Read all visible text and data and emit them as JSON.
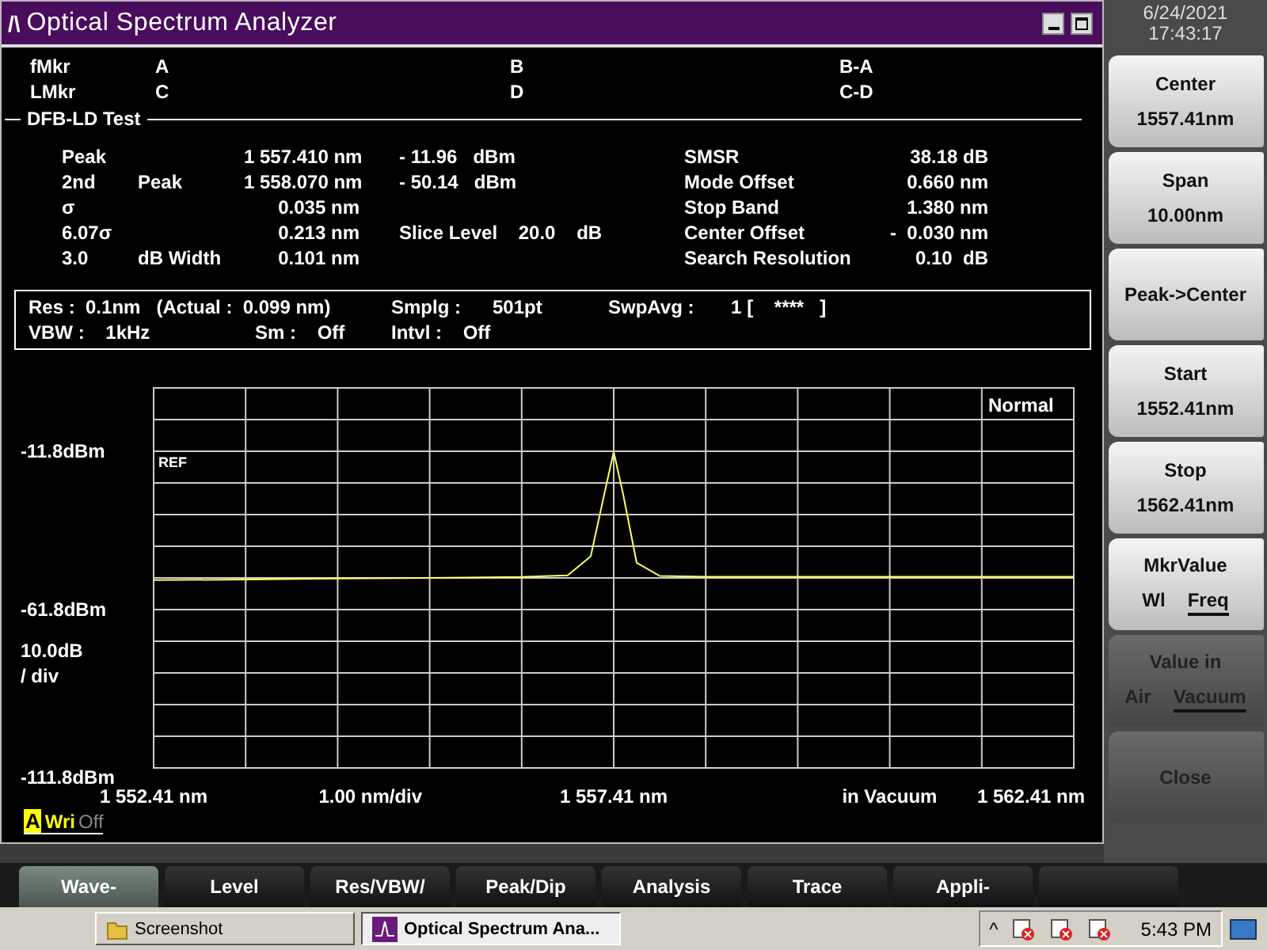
{
  "window": {
    "title": "Optical Spectrum Analyzer",
    "logo": "/\\"
  },
  "markers": [
    {
      "label": "fMkr",
      "a": "A",
      "b": "B",
      "diff": "B-A"
    },
    {
      "label": "LMkr",
      "a": "C",
      "b": "D",
      "diff": "C-D"
    }
  ],
  "test": {
    "title": "DFB-LD Test",
    "left_rows": [
      {
        "label": "Peak",
        "sub": "",
        "value": "1 557.410 nm",
        "extra": "- 11.96   dBm"
      },
      {
        "label": "2nd",
        "sub": "Peak",
        "value": "1 558.070 nm",
        "extra": "- 50.14   dBm"
      },
      {
        "label": "σ",
        "sub": "",
        "value": "0.035 nm",
        "extra": ""
      },
      {
        "label": "6.07σ",
        "sub": "",
        "value": "0.213 nm",
        "extra": "Slice Level    20.0    dB"
      },
      {
        "label": "3.0",
        "sub": "dB Width",
        "value": "0.101 nm",
        "extra": ""
      }
    ],
    "right_rows": [
      {
        "label": "SMSR",
        "value": "38.18 dB"
      },
      {
        "label": "Mode Offset",
        "value": "0.660 nm"
      },
      {
        "label": "Stop Band",
        "value": "1.380 nm"
      },
      {
        "label": "Center Offset",
        "value": "-  0.030 nm"
      },
      {
        "label": "Search Resolution",
        "value": "0.10  dB"
      }
    ]
  },
  "settings": [
    [
      "Res :  0.1nm   (Actual :  0.099 nm)",
      "Smplg :      501pt",
      "SwpAvg :       1 [    ****   ]"
    ],
    [
      "VBW :    1kHz",
      "Sm :    Off",
      "Intvl :    Off"
    ]
  ],
  "trace": {
    "mode_label": "Normal",
    "ref_label": "REF",
    "ydiv": "10.0dB\n/ div",
    "xdiv": "1.00 nm/div",
    "medium": "in Vacuum",
    "x_end_label": "1 562.41 nm",
    "write": "Wri",
    "state": "Off",
    "chart_data": {
      "type": "line",
      "x": [
        1552.41,
        1553.41,
        1554.41,
        1555.41,
        1556.41,
        1556.91,
        1557.16,
        1557.31,
        1557.41,
        1557.51,
        1557.66,
        1557.91,
        1558.41,
        1559.41,
        1560.41,
        1561.41,
        1562.41
      ],
      "series": [
        {
          "name": "A",
          "color": "#ffff66",
          "values": [
            -52.5,
            -52.3,
            -52.0,
            -51.8,
            -51.5,
            -51.0,
            -45,
            -25,
            -12.0,
            -25,
            -47,
            -51.2,
            -51.4,
            -51.4,
            -51.4,
            -51.4,
            -51.4
          ]
        }
      ],
      "grid": true,
      "xlim": [
        1552.41,
        1562.41
      ],
      "ylim": [
        -111.8,
        8.2
      ],
      "xticks": [
        {
          "value": 1552.41,
          "label": "1 552.41 nm"
        },
        {
          "value": 1557.41,
          "label": "1 557.41 nm"
        }
      ],
      "yticks": [
        {
          "value": -11.8,
          "label": "-11.8dBm"
        },
        {
          "value": -61.8,
          "label": "-61.8dBm"
        },
        {
          "value": -111.8,
          "label": "-111.8dBm"
        }
      ]
    }
  },
  "clock": {
    "date": "6/24/2021",
    "time": "17:43:17"
  },
  "softkeys": [
    {
      "kind": "value",
      "label": "Center",
      "value": "1557.41nm",
      "dimmed": false
    },
    {
      "kind": "value",
      "label": "Span",
      "value": "10.00nm",
      "dimmed": false
    },
    {
      "kind": "action",
      "label": "Peak->Center",
      "dimmed": false
    },
    {
      "kind": "value",
      "label": "Start",
      "value": "1552.41nm",
      "dimmed": false
    },
    {
      "kind": "value",
      "label": "Stop",
      "value": "1562.41nm",
      "dimmed": false
    },
    {
      "kind": "toggle",
      "label": "MkrValue",
      "options": [
        {
          "label": "Wl",
          "selected": false
        },
        {
          "label": "Freq",
          "selected": true
        }
      ],
      "dimmed": false
    },
    {
      "kind": "toggle",
      "label": "Value in",
      "options": [
        {
          "label": "Air",
          "selected": false
        },
        {
          "label": "Vacuum",
          "selected": true
        }
      ],
      "dimmed": true
    },
    {
      "kind": "action",
      "label": "Close",
      "dimmed": true
    }
  ],
  "tabs": [
    {
      "label": "Wave-",
      "selected": true
    },
    {
      "label": "Level",
      "selected": false
    },
    {
      "label": "Res/VBW/",
      "selected": false
    },
    {
      "label": "Peak/Dip",
      "selected": false
    },
    {
      "label": "Analysis",
      "selected": false
    },
    {
      "label": "Trace",
      "selected": false
    },
    {
      "label": "Appli-",
      "selected": false
    },
    {
      "selected": false
    }
  ],
  "taskbar": {
    "items": [
      {
        "label": "Screenshot",
        "kind": "folder",
        "selected": false
      },
      {
        "label": "Optical Spectrum Ana...",
        "kind": "app",
        "selected": true
      }
    ],
    "tray_chevron": "^",
    "time": "5:43 PM"
  }
}
